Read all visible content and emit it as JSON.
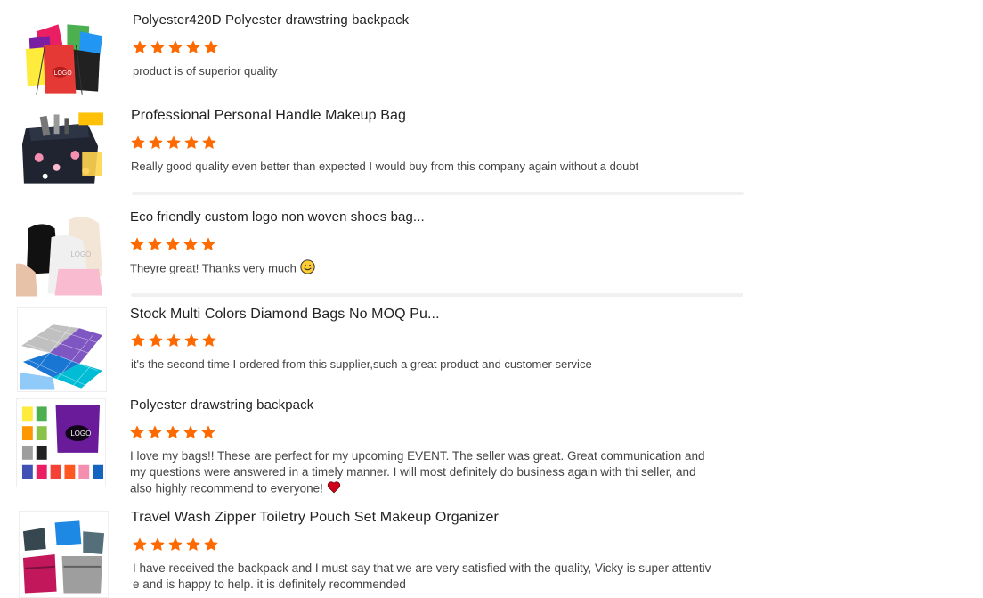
{
  "star_color": "#ff6a00",
  "reviews": [
    {
      "title": "Polyester420D Polyester drawstring backpack",
      "rating": 5,
      "text": "product is of superior quality",
      "thumb_icon": "drawstring-bags-image"
    },
    {
      "title": "Professional Personal Handle Makeup Bag",
      "rating": 5,
      "text": "Really good quality even better than expected I would buy from this company again without a doubt",
      "thumb_icon": "makeup-bag-image"
    },
    {
      "title": "Eco friendly custom logo non woven shoes bag...",
      "rating": 5,
      "text": "Theyre great! Thanks very much",
      "emoji": "smile-emoji",
      "thumb_icon": "shoe-bags-image"
    },
    {
      "title": "Stock Multi Colors Diamond Bags No MOQ Pu...",
      "rating": 5,
      "text": "it's the second time I ordered from this supplier,such a great product and customer service",
      "thumb_icon": "diamond-bags-image"
    },
    {
      "title": "Polyester drawstring backpack",
      "rating": 5,
      "text": "I love my bags!! These are perfect for my upcoming EVENT. The seller was great. Great communication and my questions were answered in a timely manner. I will most definitely do business again with thi seller, and also highly recommend to everyone!",
      "emoji": "heart-emoji",
      "thumb_icon": "drawstring-backpacks-image"
    },
    {
      "title": "Travel Wash Zipper Toiletry Pouch Set Makeup Organizer",
      "rating": 5,
      "text": "I have received the backpack and I must say that we are very satisfied with the quality, Vicky is super attentive and is happy to help. it is definitely recommended",
      "thumb_icon": "toiletry-pouch-image"
    }
  ]
}
